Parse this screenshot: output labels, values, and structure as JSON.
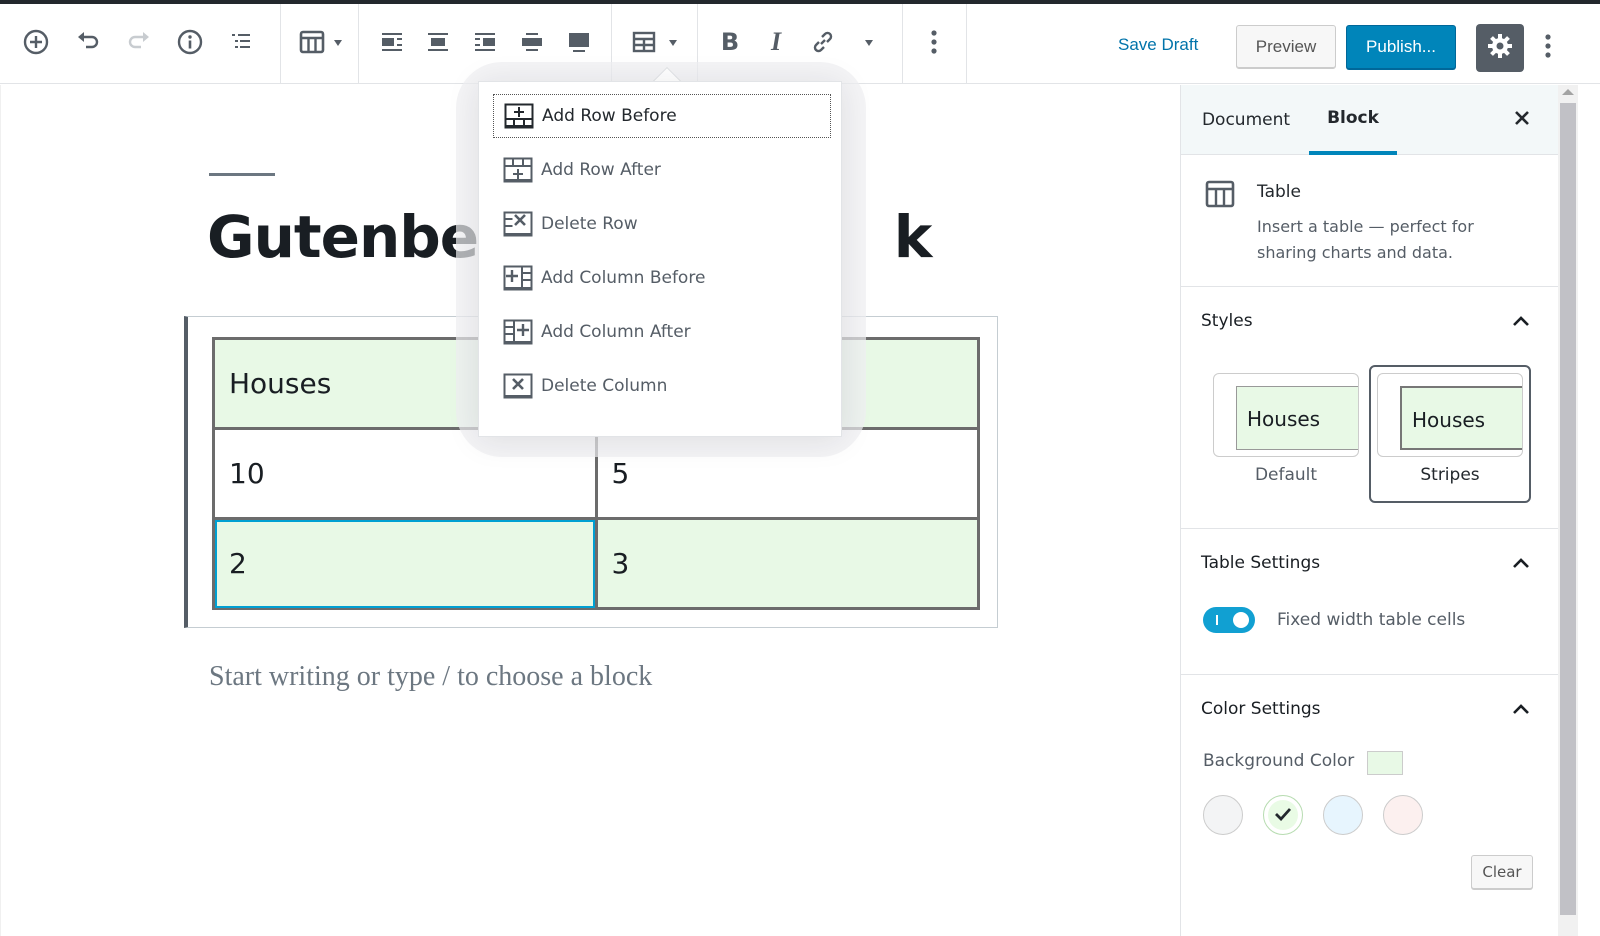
{
  "toolbar": {
    "add_block": "add-block-icon",
    "undo": "undo-icon",
    "redo": "redo-icon",
    "info": "info-icon",
    "outline": "block-navigation-icon",
    "block_type": "table-icon",
    "align_options": [
      "align-left-icon",
      "align-center-icon",
      "align-right-icon",
      "align-wide-icon",
      "align-full-icon"
    ],
    "edit_table": "edit-table-icon",
    "format": [
      "bold-icon",
      "italic-icon",
      "link-icon"
    ],
    "more_rich_text": "chevron-down-icon",
    "more_block": "more-vertical-icon",
    "save_draft": "Save Draft",
    "preview": "Preview",
    "publish": "Publish...",
    "settings": "gear-icon",
    "more_options": "more-vertical-icon"
  },
  "editor": {
    "title_visible_left": "Gutenber",
    "title_visible_right": "k",
    "title_full": "Gutenberg Table Block",
    "table": {
      "rows": [
        [
          "Houses",
          ""
        ],
        [
          "10",
          "5"
        ],
        [
          "2",
          "3"
        ]
      ],
      "selected_cell": [
        2,
        0
      ]
    },
    "placeholder": "Start writing or type / to choose a block"
  },
  "edit_table_menu": {
    "items": [
      {
        "label": "Add Row Before",
        "icon": "table-row-before-icon",
        "focused": true
      },
      {
        "label": "Add Row After",
        "icon": "table-row-after-icon",
        "focused": false
      },
      {
        "label": "Delete Row",
        "icon": "table-row-delete-icon",
        "focused": false
      },
      {
        "label": "Add Column Before",
        "icon": "table-col-before-icon",
        "focused": false
      },
      {
        "label": "Add Column After",
        "icon": "table-col-after-icon",
        "focused": false
      },
      {
        "label": "Delete Column",
        "icon": "table-col-delete-icon",
        "focused": false
      }
    ]
  },
  "sidebar": {
    "tabs": [
      {
        "label": "Document",
        "active": false
      },
      {
        "label": "Block",
        "active": true
      }
    ],
    "block_card": {
      "title": "Table",
      "description": "Insert a table — perfect for sharing charts and data."
    },
    "styles": {
      "title": "Styles",
      "options": [
        {
          "label": "Default",
          "preview_text": "Houses",
          "active": false
        },
        {
          "label": "Stripes",
          "preview_text": "Houses",
          "active": true
        }
      ]
    },
    "table_settings": {
      "title": "Table Settings",
      "toggle_label": "Fixed width table cells",
      "toggle_on": true
    },
    "color_settings": {
      "title": "Color Settings",
      "background_label": "Background Color",
      "current_color": "#e8f9e6",
      "swatches": [
        {
          "name": "subtle-light-gray",
          "color": "#f3f4f5",
          "selected": false
        },
        {
          "name": "subtle-pale-green",
          "color": "#e9fbe5",
          "selected": true
        },
        {
          "name": "subtle-pale-blue",
          "color": "#e7f5fe",
          "selected": false
        },
        {
          "name": "subtle-pale-pink",
          "color": "#fcf0ef",
          "selected": false
        }
      ],
      "clear": "Clear"
    }
  },
  "colors": {
    "accent": "#0085ba",
    "link": "#0073aa",
    "toggle": "#11a0d2",
    "stripe": "#e8f9e6"
  }
}
